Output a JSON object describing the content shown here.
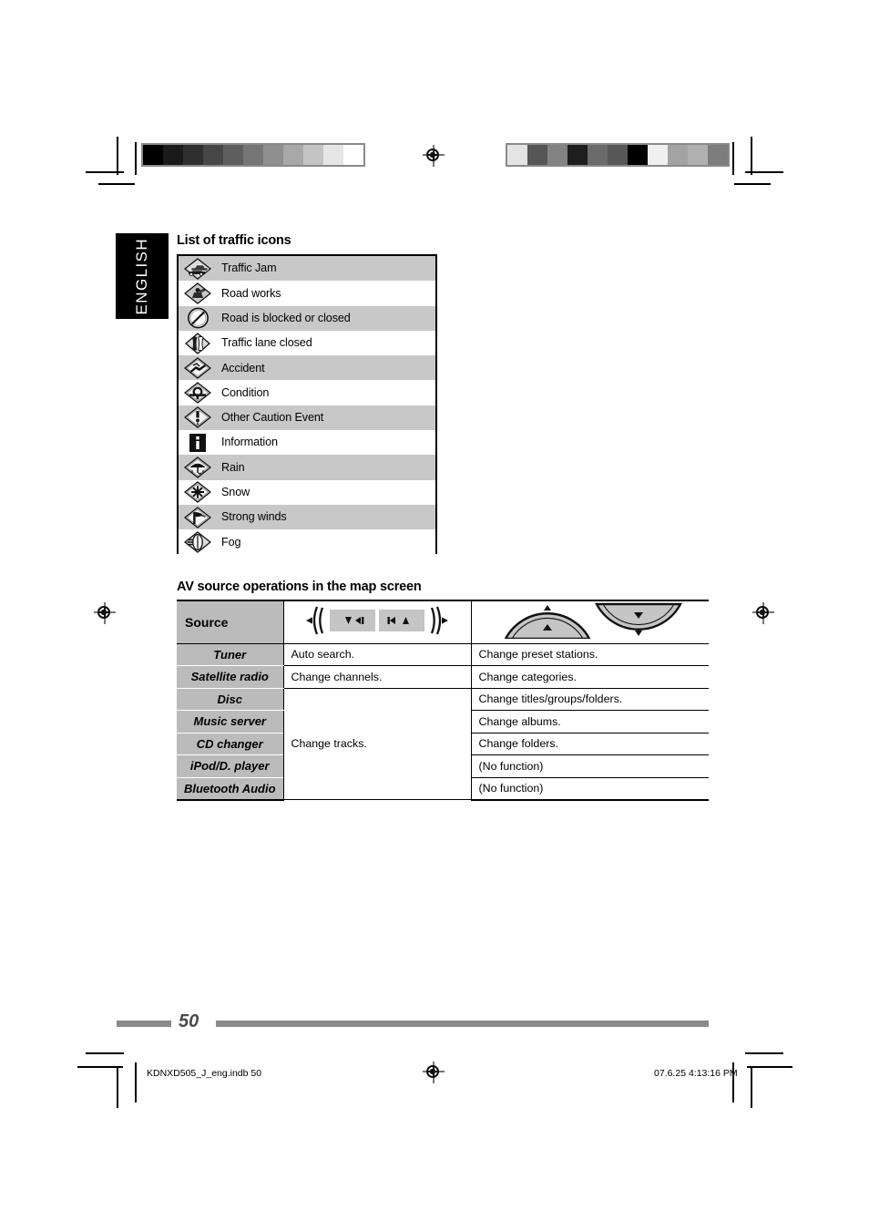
{
  "page": {
    "language_tab": "ENGLISH",
    "page_number": "50",
    "footer_file": "KDNXD505_J_eng.indb   50",
    "footer_timestamp": "07.6.25   4:13:16 PM"
  },
  "calibration": {
    "left_bar_label": "grayscale-step-wedge",
    "left_swatches": [
      "#000000",
      "#1a1a1a",
      "#2f2f2f",
      "#474747",
      "#5e5e5e",
      "#767676",
      "#8f8f8f",
      "#a8a8a8",
      "#c4c4c4",
      "#e6e6e6",
      "#ffffff"
    ],
    "right_bar_label": "randomized-gray-patches",
    "right_swatches": [
      "#e4e4e4",
      "#565656",
      "#838383",
      "#1e1e1e",
      "#6b6b6b",
      "#575757",
      "#000000",
      "#f0f0f0",
      "#a3a3a3",
      "#b0b0b0",
      "#7d7d7d"
    ]
  },
  "traffic_section": {
    "heading": "List of traffic icons",
    "items": [
      {
        "label": "Traffic Jam",
        "icon": "traffic-jam-icon",
        "shaded": true
      },
      {
        "label": "Road works",
        "icon": "road-works-icon",
        "shaded": false
      },
      {
        "label": "Road is blocked or closed",
        "icon": "road-blocked-icon",
        "shaded": true
      },
      {
        "label": "Traffic lane closed",
        "icon": "lane-closed-icon",
        "shaded": false
      },
      {
        "label": "Accident",
        "icon": "accident-icon",
        "shaded": true
      },
      {
        "label": "Condition",
        "icon": "condition-icon",
        "shaded": false
      },
      {
        "label": "Other Caution Event",
        "icon": "other-caution-icon",
        "shaded": true
      },
      {
        "label": "Information",
        "icon": "information-icon",
        "shaded": false
      },
      {
        "label": "Rain",
        "icon": "rain-icon",
        "shaded": true
      },
      {
        "label": "Snow",
        "icon": "snow-icon",
        "shaded": false
      },
      {
        "label": "Strong winds",
        "icon": "strong-winds-icon",
        "shaded": true
      },
      {
        "label": "Fog",
        "icon": "fog-icon",
        "shaded": false
      }
    ]
  },
  "av_section": {
    "heading": "AV source operations in the map screen",
    "columns": {
      "source": "Source",
      "col2_icon": "track-rocker-button-icon",
      "col3_icon": "updown-rocker-button-icon"
    },
    "rows": [
      {
        "source": "Tuner",
        "col2": "Auto search.",
        "col3": "Change preset stations."
      },
      {
        "source": "Satellite radio",
        "col2": "Change channels.",
        "col3": "Change categories."
      },
      {
        "source": "Disc",
        "col2": "",
        "col3": "Change titles/groups/folders."
      },
      {
        "source": "Music server",
        "col2": "",
        "col3": "Change albums."
      },
      {
        "source": "CD changer",
        "col2": "Change tracks.",
        "col3": "Change folders."
      },
      {
        "source": "iPod/D. player",
        "col2": "",
        "col3": "(No function)"
      },
      {
        "source": "Bluetooth Audio",
        "col2": "",
        "col3": "(No function)"
      }
    ]
  },
  "colors": {
    "row_shade": "#c8c8c8",
    "source_cell": "#bbbbbb",
    "footer_bar": "#8a8a8a",
    "tab_bg": "#000000"
  }
}
